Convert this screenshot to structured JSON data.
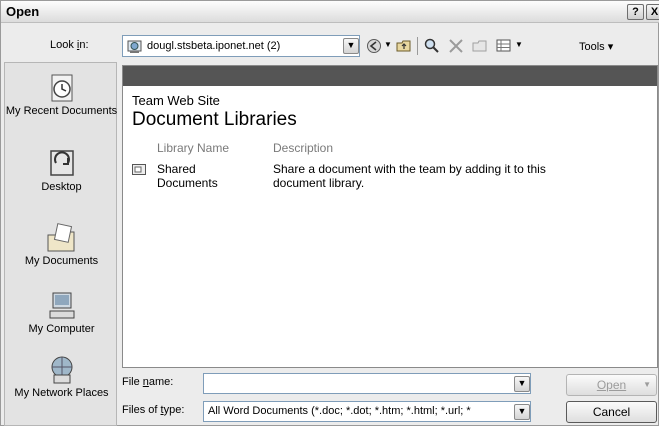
{
  "window": {
    "title": "Open",
    "help_label": "?",
    "close_label": "X"
  },
  "lookin": {
    "label_prefix": "Look ",
    "label_accel": "i",
    "label_suffix": "n:",
    "value": "dougl.stsbeta.iponet.net (2)"
  },
  "toolbar": {
    "tools_label": "Tools ▾",
    "icons": [
      "back-icon",
      "up-folder-icon",
      "search-web-icon",
      "delete-icon",
      "new-folder-icon",
      "views-icon"
    ]
  },
  "places": [
    {
      "label": "My Recent Documents",
      "icon": "recent-documents-icon"
    },
    {
      "label": "Desktop",
      "icon": "desktop-icon"
    },
    {
      "label": "My Documents",
      "icon": "my-documents-icon"
    },
    {
      "label": "My Computer",
      "icon": "my-computer-icon"
    },
    {
      "label": "My Network Places",
      "icon": "network-places-icon"
    }
  ],
  "browser": {
    "site_title": "Team Web Site",
    "heading": "Document Libraries",
    "columns": {
      "name": "Library Name",
      "description": "Description"
    },
    "libraries": [
      {
        "name_line1": "Shared",
        "name_line2": "Documents",
        "desc_line1": "Share a document with the team by adding it to this",
        "desc_line2": "document library."
      }
    ]
  },
  "file_name": {
    "label_prefix": "File ",
    "label_accel": "n",
    "label_suffix": "ame:",
    "value": ""
  },
  "file_type": {
    "label_prefix": "Files of ",
    "label_accel": "t",
    "label_suffix": "ype:",
    "value": "All Word Documents (*.doc; *.dot; *.htm; *.html; *.url; *"
  },
  "buttons": {
    "open": "Open",
    "cancel": "Cancel"
  },
  "colors": {
    "header_bar": "#555555",
    "dialog_bg": "#ececec"
  }
}
